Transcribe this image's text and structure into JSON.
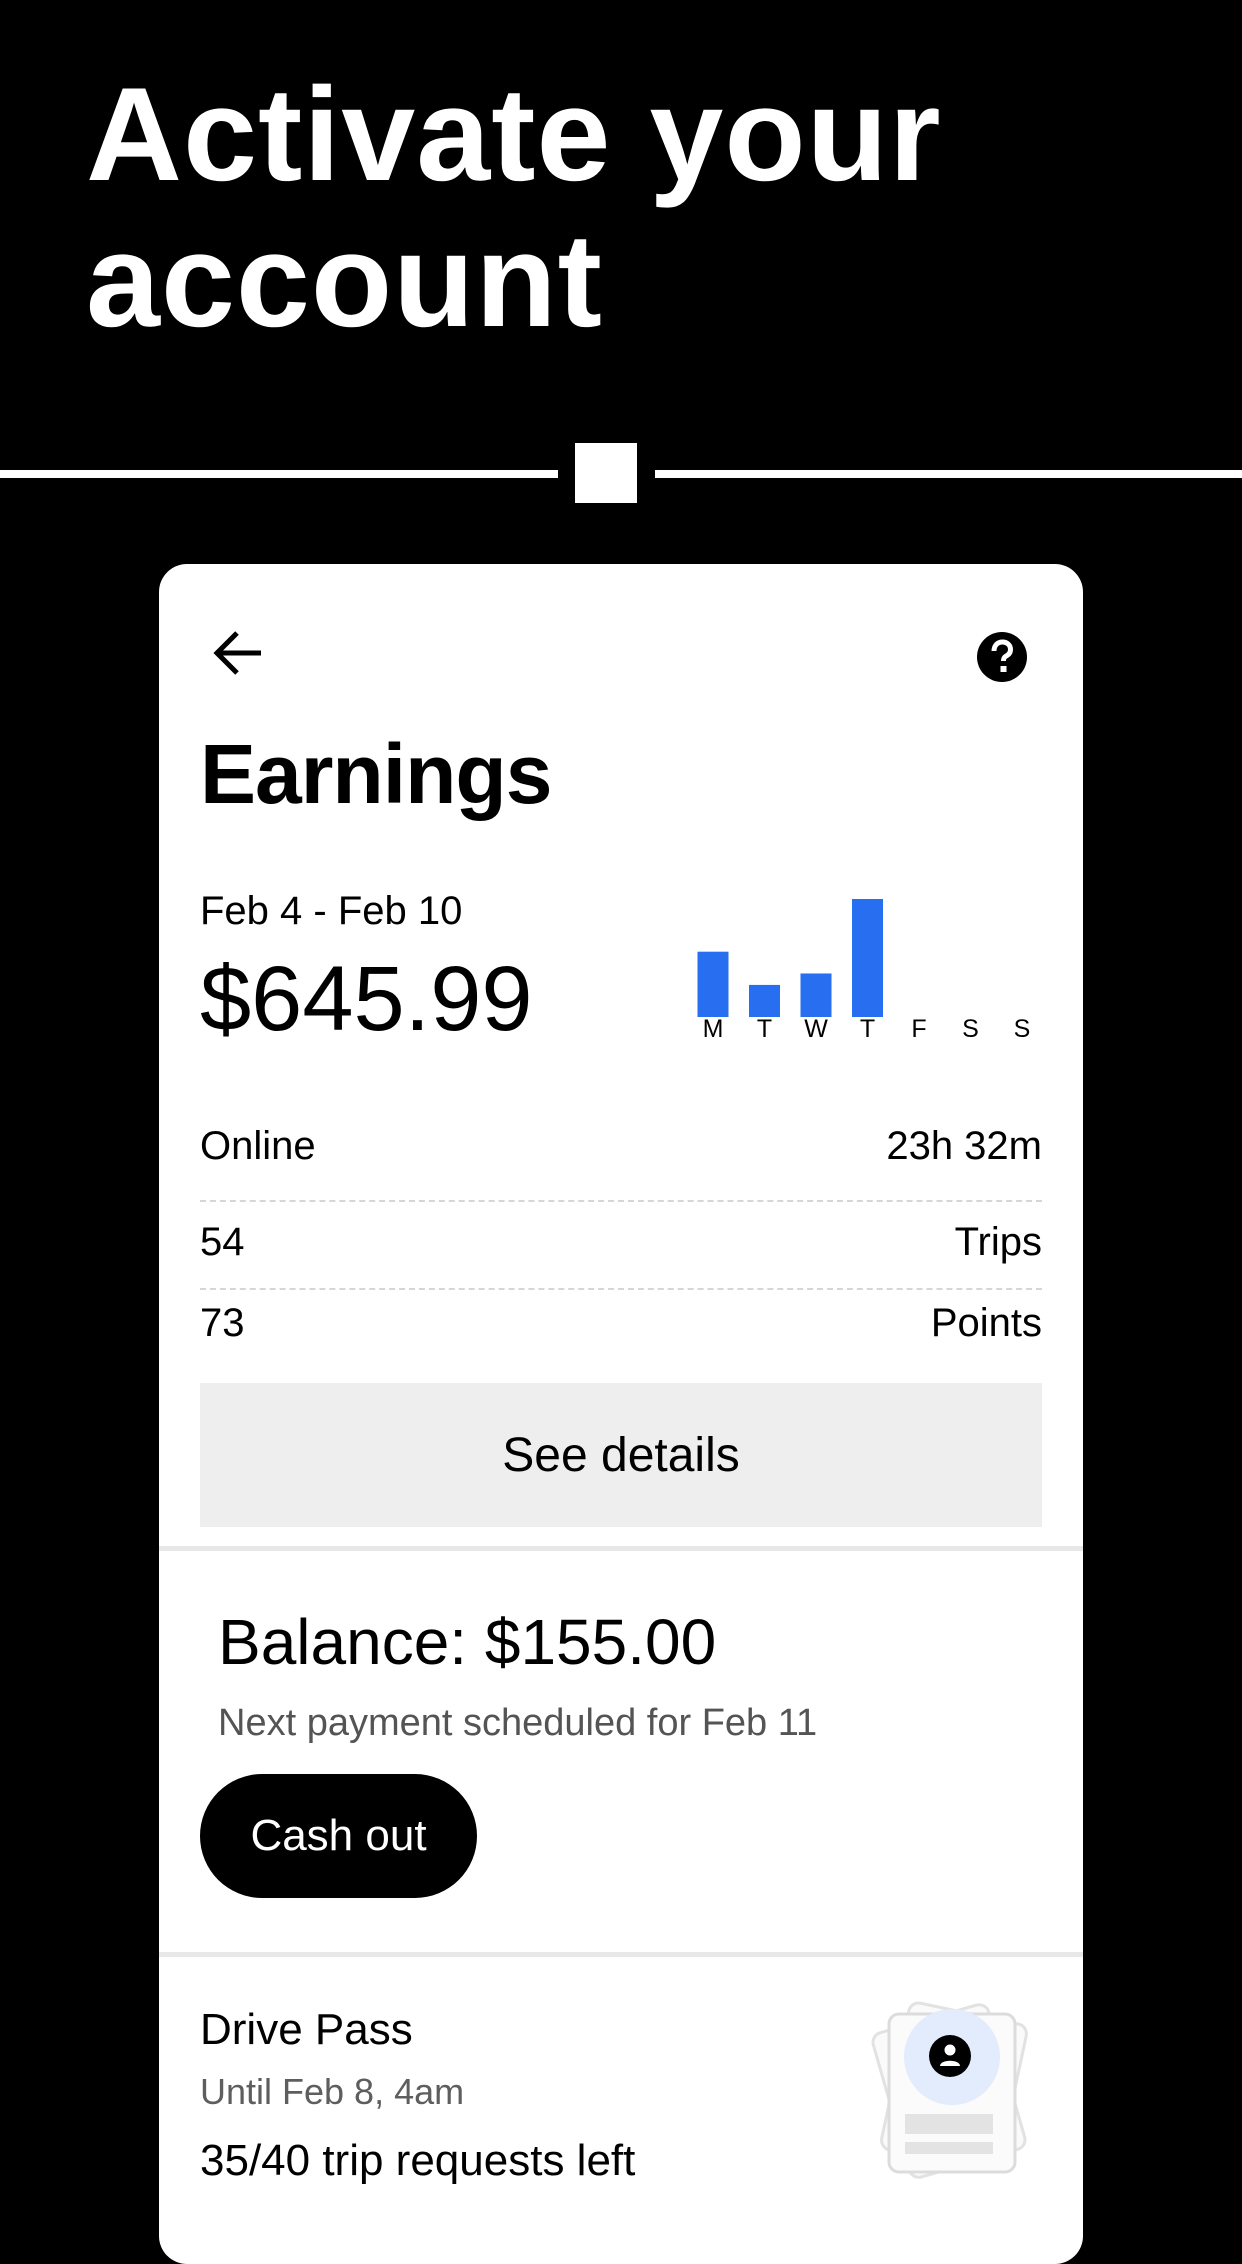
{
  "hero": {
    "title_line1": "Activate your",
    "title_line2": "account"
  },
  "card": {
    "back_icon": "arrow-left",
    "help_icon": "question-circle",
    "title": "Earnings",
    "date_range": "Feb 4 - Feb 10",
    "total": "$645.99"
  },
  "chart_data": {
    "type": "bar",
    "categories": [
      "M",
      "T",
      "W",
      "T",
      "F",
      "S",
      "S"
    ],
    "values": [
      57,
      28,
      38,
      103,
      0,
      0,
      0
    ],
    "bar_color": "#276EF1",
    "title": "",
    "xlabel": "",
    "ylabel": ""
  },
  "stats": {
    "online_label": "Online",
    "online_value": "23h 32m",
    "trips_count": "54",
    "trips_label": "Trips",
    "points_count": "73",
    "points_label": "Points"
  },
  "details_button": "See details",
  "balance": {
    "title": "Balance: $155.00",
    "subtitle": "Next payment scheduled for Feb 11",
    "cashout_button": "Cash out"
  },
  "drive_pass": {
    "title": "Drive Pass",
    "until": "Until Feb 8, 4am",
    "requests_left": "35/40 trip requests left",
    "illustration_icon": "pass-card-icon"
  },
  "colors": {
    "background": "#000000",
    "accent": "#276EF1",
    "button_gray": "#EEEEEE"
  }
}
